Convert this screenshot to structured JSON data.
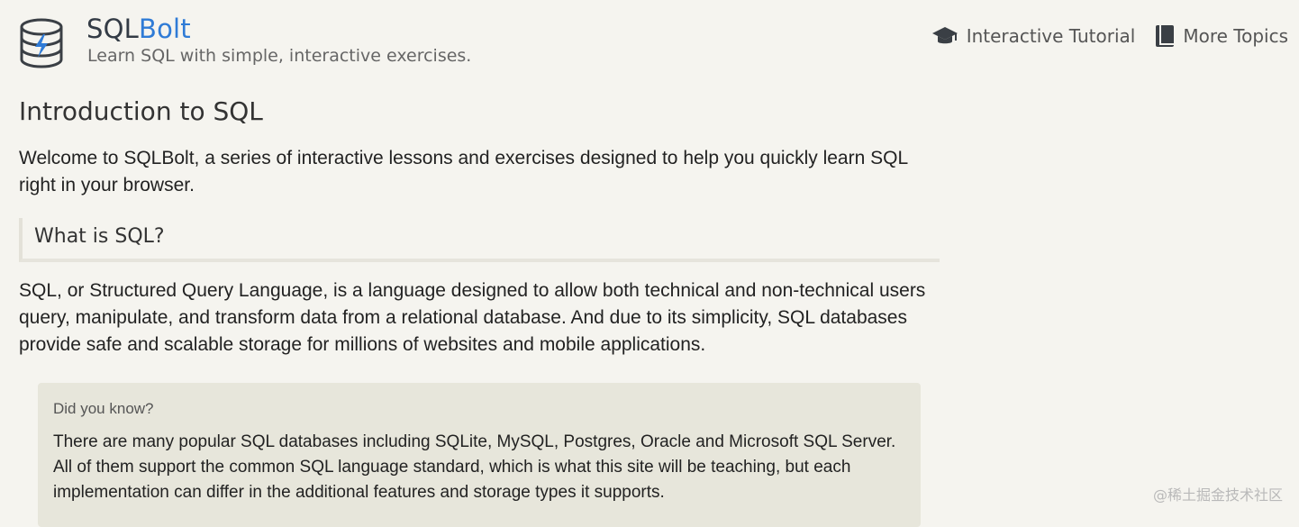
{
  "header": {
    "brand_part1": "SQL",
    "brand_part2": "Bolt",
    "tagline": "Learn SQL with simple, interactive exercises.",
    "logo_icon": "database-bolt-icon",
    "accent_color": "#2f7bd6"
  },
  "nav": {
    "items": [
      {
        "label": "Interactive Tutorial",
        "icon": "graduation-cap-icon"
      },
      {
        "label": "More Topics",
        "icon": "book-icon"
      }
    ]
  },
  "main": {
    "title": "Introduction to SQL",
    "intro": "Welcome to SQLBolt, a series of interactive lessons and exercises designed to help you quickly learn SQL right in your browser.",
    "section_heading": "What is SQL?",
    "section_body": "SQL, or Structured Query Language, is a language designed to allow both technical and non-technical users query, manipulate, and transform data from a relational database. And due to its simplicity, SQL databases provide safe and scalable storage for millions of websites and mobile applications."
  },
  "callout": {
    "title": "Did you know?",
    "text": "There are many popular SQL databases including SQLite, MySQL, Postgres, Oracle and Microsoft SQL Server. All of them support the common SQL language standard, which is what this site will be teaching, but each implementation can differ in the additional features and storage types it supports."
  },
  "watermark": "@稀土掘金技术社区"
}
